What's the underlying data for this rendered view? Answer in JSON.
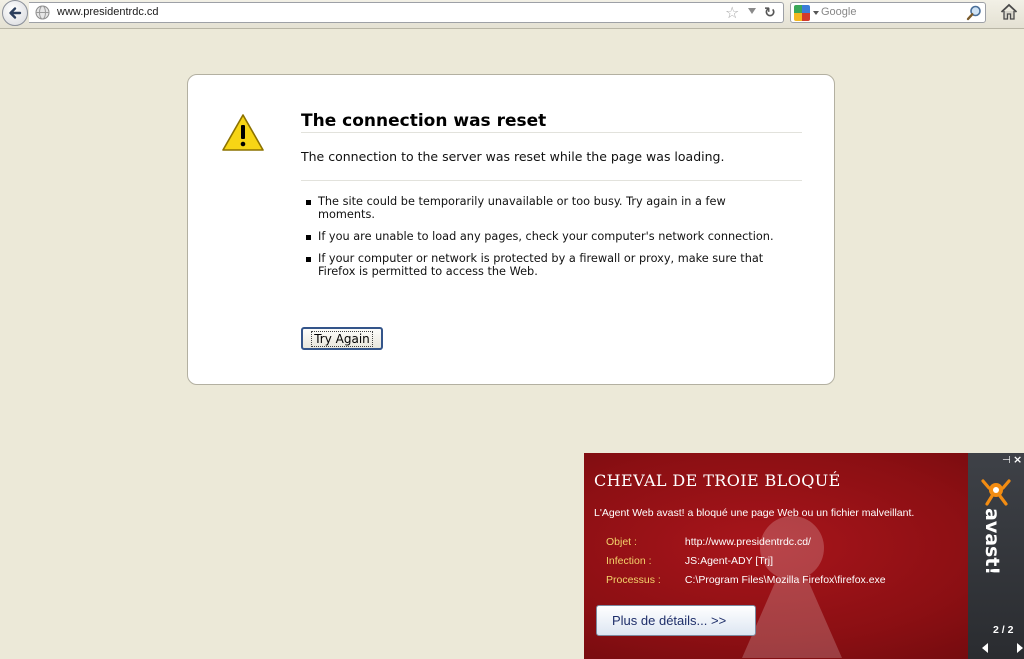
{
  "toolbar": {
    "url": "www.presidentrdc.cd",
    "search_placeholder": "Google"
  },
  "error": {
    "title": "The connection was reset",
    "short_desc": "The connection to the server was reset while the page was loading.",
    "items": [
      "The site could be temporarily unavailable or too busy. Try again in a few moments.",
      "If you are unable to load any pages, check your computer's network connection.",
      "If your computer or network is protected by a firewall or proxy, make sure that Firefox is permitted to access the Web."
    ],
    "try_again_label": "Try Again"
  },
  "avast": {
    "title": "CHEVAL DE TROIE BLOQUÉ",
    "message": "L'Agent Web avast! a bloqué une page Web ou un fichier malveillant.",
    "rows": [
      {
        "label": "Objet :",
        "value": "http://www.presidentrdc.cd/"
      },
      {
        "label": "Infection :",
        "value": "JS:Agent-ADY [Trj]"
      },
      {
        "label": "Processus :",
        "value": "C:\\Program Files\\Mozilla Firefox\\firefox.exe"
      }
    ],
    "details_label": "Plus de détails...  >>",
    "brand": "avast!",
    "pager": "2 / 2",
    "colors": {
      "background": "#8b0f13",
      "label": "#f3d36b",
      "side": "#2f3236"
    }
  },
  "icons": [
    "back-arrow-icon",
    "globe-icon",
    "star-icon",
    "dropdown-icon",
    "reload-icon",
    "google-icon",
    "search-icon",
    "home-icon",
    "warning-icon",
    "pin-icon",
    "close-icon",
    "avast-mascot-icon"
  ]
}
